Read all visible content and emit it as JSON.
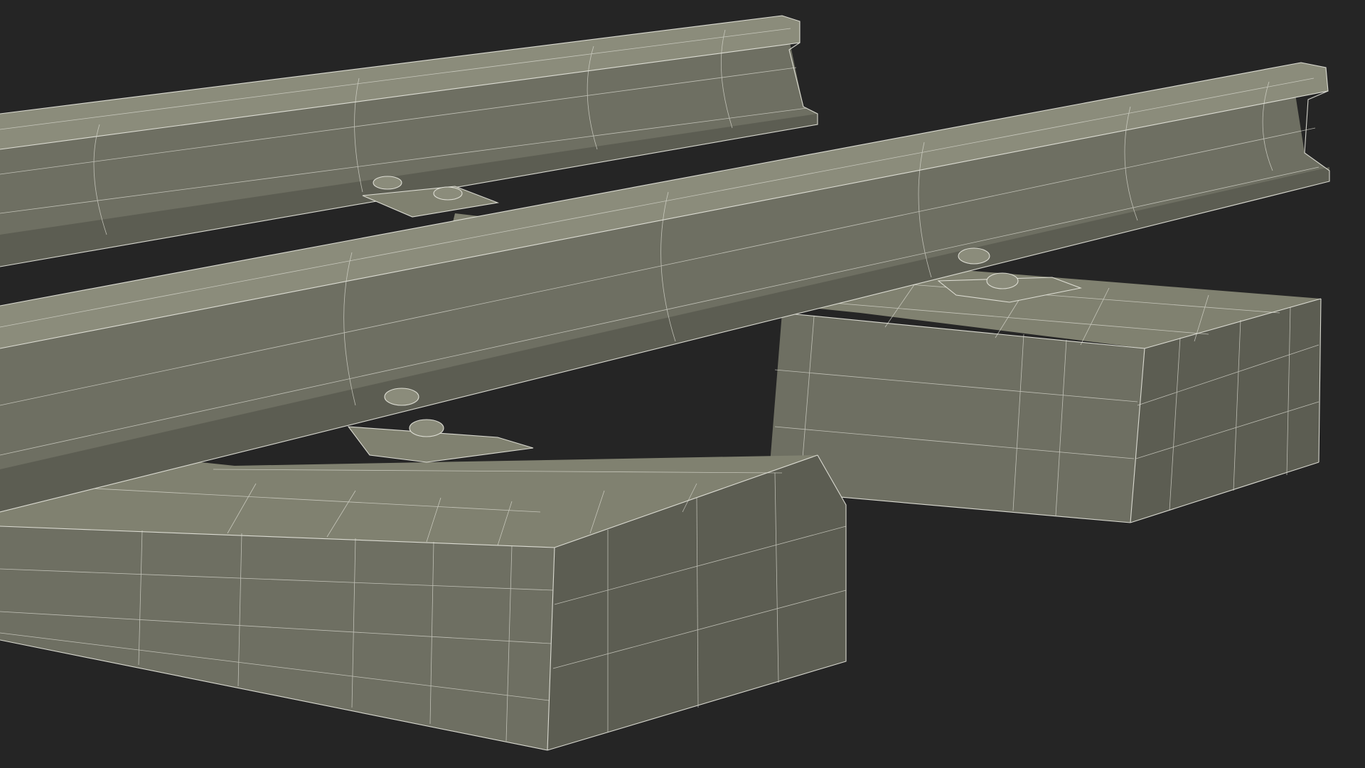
{
  "scene": {
    "background_color": "#252525",
    "model_color": "#7a7b6b",
    "wireframe_color": "#e8e8df"
  }
}
